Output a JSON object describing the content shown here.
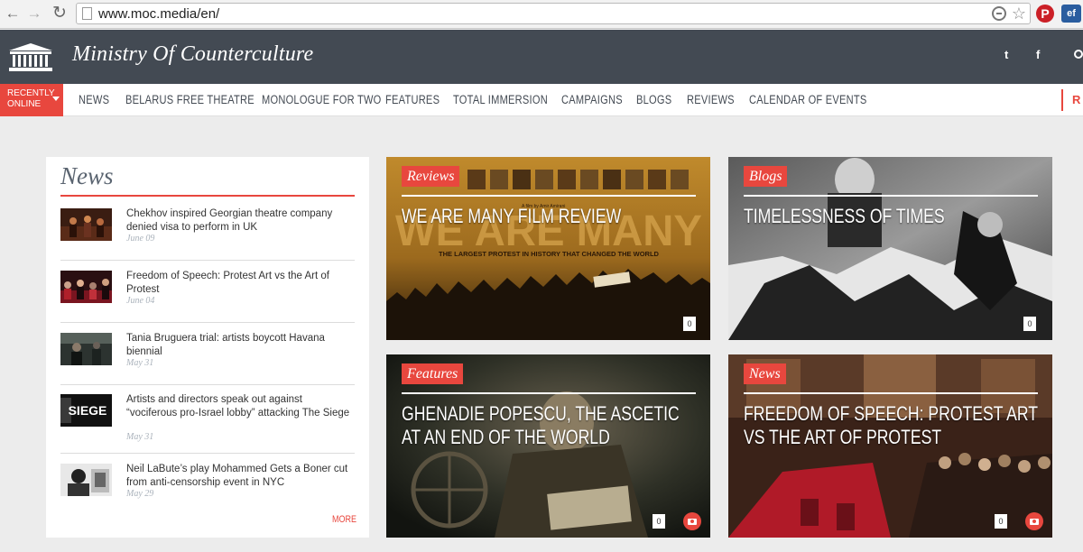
{
  "browser": {
    "url": "www.moc.media/en/",
    "ext_pinterest": "P",
    "ext_ef": "ef"
  },
  "header": {
    "brand": "Ministry Of Counterculture",
    "twitter": "t",
    "facebook": "f"
  },
  "nav": {
    "recent_line1": "RECENTLY",
    "recent_line2": "ONLINE",
    "items": [
      "NEWS",
      "BELARUS FREE THEATRE",
      "MONOLOGUE FOR TWO",
      "FEATURES",
      "TOTAL IMMERSION",
      "CAMPAIGNS",
      "BLOGS",
      "REVIEWS",
      "CALENDAR OF EVENTS"
    ],
    "right_label": "R"
  },
  "news": {
    "title": "News",
    "more": "MORE",
    "items": [
      {
        "headline": "Chekhov inspired Georgian theatre company denied visa to perform in UK",
        "date": "June 09"
      },
      {
        "headline": "Freedom of Speech: Protest Art vs the Art of Protest",
        "date": "June 04"
      },
      {
        "headline": "Tania Bruguera trial: artists boycott Havana biennial",
        "date": "May 31"
      },
      {
        "headline": "Artists and directors speak out against “vociferous pro-Israel lobby” attacking The Siege",
        "date": "May 31"
      },
      {
        "headline": "Neil LaBute’s play Mohammed Gets a Boner cut from anti-censorship event in NYC",
        "date": "May 29"
      }
    ],
    "siege_thumb_text": "SIEGE"
  },
  "cards": [
    {
      "tag": "Reviews",
      "title": "WE ARE MANY FILM REVIEW",
      "count": "0",
      "poster_big": "WE ARE MANY",
      "poster_sub": "THE LARGEST PROTEST IN HISTORY THAT CHANGED THE WORLD",
      "poster_credit": "A film by Amir Amirani"
    },
    {
      "tag": "Blogs",
      "title": "TIMELESSNESS OF TIMES",
      "count": "0"
    },
    {
      "tag": "Features",
      "title": "GHENADIE POPESCU, THE ASCETIC AT AN END OF THE WORLD",
      "count": "0"
    },
    {
      "tag": "News",
      "title": "FREEDOM OF SPEECH: PROTEST ART VS THE ART OF PROTEST",
      "count": "0"
    }
  ]
}
